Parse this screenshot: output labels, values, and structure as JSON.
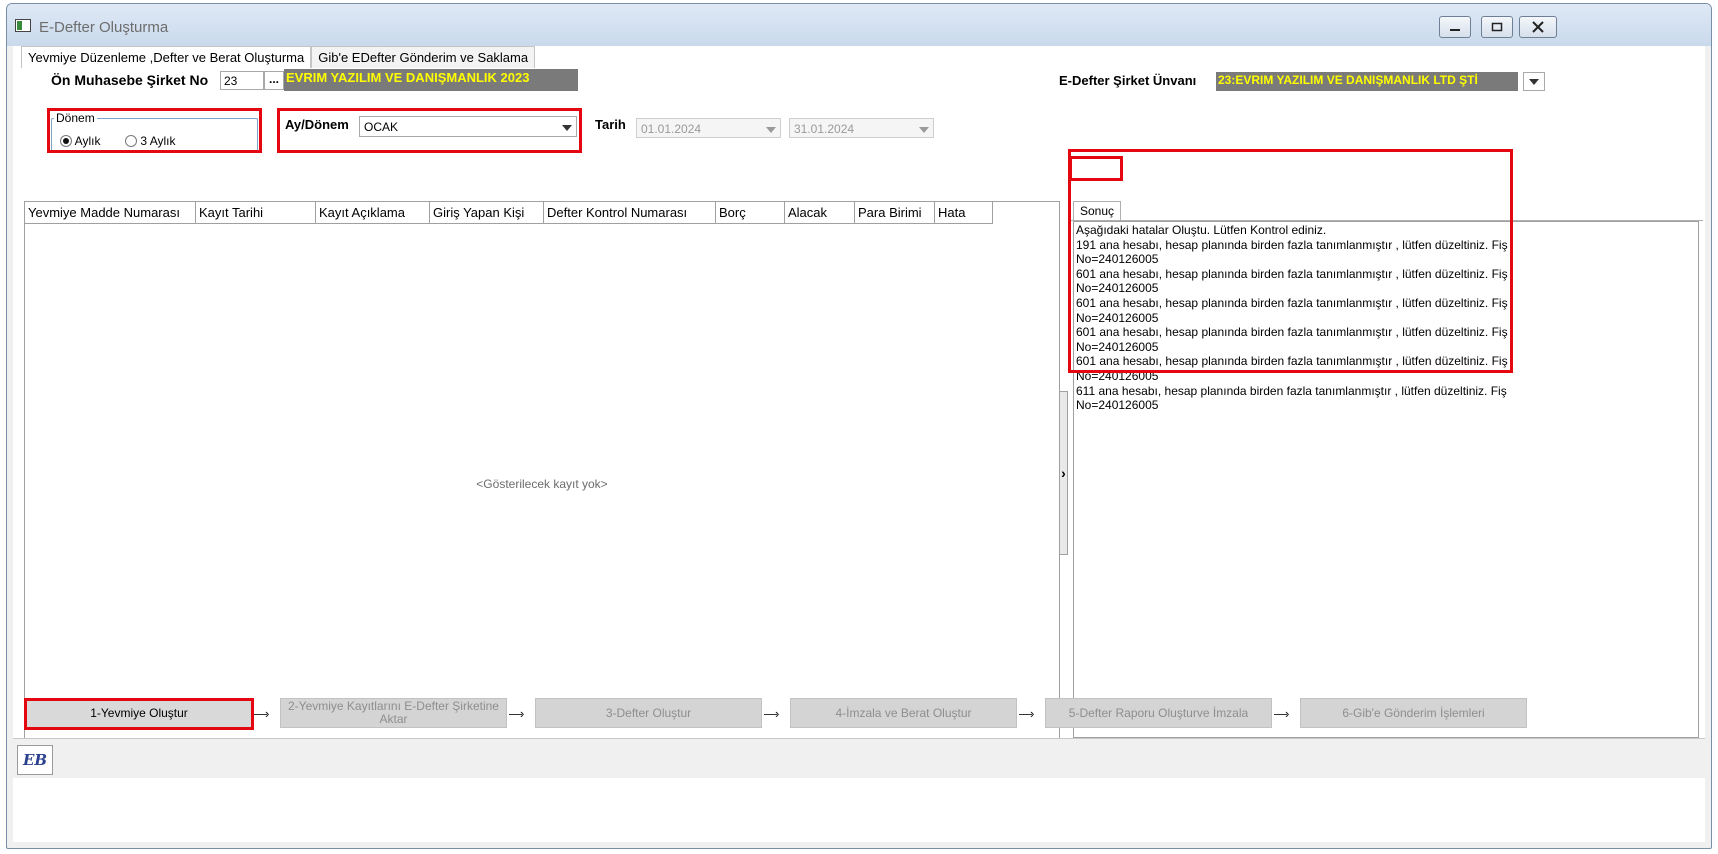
{
  "window": {
    "title": "E-Defter Oluşturma"
  },
  "tabs": [
    {
      "label": "Yevmiye Düzenleme ,Defter ve Berat Oluşturma"
    },
    {
      "label": "Gib'e EDefter Gönderim ve Saklama"
    }
  ],
  "company": {
    "label": "Ön Muhasebe Şirket No",
    "no": "23",
    "browse": "...",
    "name": "EVRIM YAZILIM  VE DANIŞMANLIK 2023",
    "edefter_label": "E-Defter Şirket Ünvanı",
    "edefter_value": "23:EVRIM YAZILIM VE DANIŞMANLIK LTD ŞTİ"
  },
  "period": {
    "group_label": "Dönem",
    "options": [
      {
        "label": "Aylık",
        "selected": true
      },
      {
        "label": "3 Aylık",
        "selected": false
      }
    ],
    "ay_label": "Ay/Dönem",
    "ay_value": "OCAK",
    "tarih_label": "Tarih",
    "date_from": "01.01.2024",
    "date_to": "31.01.2024"
  },
  "grid": {
    "columns": [
      "Yevmiye Madde Numarası",
      "Kayıt Tarihi",
      "Kayıt Açıklama",
      "Giriş Yapan Kişi",
      "Defter Kontrol Numarası",
      "Borç",
      "Alacak",
      "Para Birimi",
      "Hata"
    ],
    "empty_text": "<Gösterilecek kayıt yok>"
  },
  "result": {
    "tab_label": "Sonuç",
    "lines": [
      "Aşağıdaki hatalar Oluştu. Lütfen Kontrol ediniz.",
      "191 ana hesabı, hesap planında birden fazla tanımlanmıştır , lütfen düzeltiniz. Fiş",
      "No=240126005",
      "601 ana hesabı, hesap planında birden fazla tanımlanmıştır , lütfen düzeltiniz. Fiş",
      "No=240126005",
      "601 ana hesabı, hesap planında birden fazla tanımlanmıştır , lütfen düzeltiniz. Fiş",
      "No=240126005",
      "601 ana hesabı, hesap planında birden fazla tanımlanmıştır , lütfen düzeltiniz. Fiş",
      "No=240126005",
      "601 ana hesabı, hesap planında birden fazla tanımlanmıştır , lütfen düzeltiniz. Fiş",
      "No=240126005",
      "611 ana hesabı, hesap planında birden fazla tanımlanmıştır , lütfen düzeltiniz. Fiş",
      "No=240126005"
    ]
  },
  "steps": [
    {
      "label": "1-Yevmiye Oluştur",
      "active": true
    },
    {
      "label": "2-Yevmiye Kayıtlarını E-Defter Şirketine Aktar",
      "active": false
    },
    {
      "label": "3-Defter Oluştur",
      "active": false
    },
    {
      "label": "4-İmzala ve Berat Oluştur",
      "active": false
    },
    {
      "label": "5-Defter Raporu Oluşturve İmzala",
      "active": false
    },
    {
      "label": "6-Gib'e Gönderim İşlemleri",
      "active": false
    }
  ],
  "step_arrow": "—›",
  "colors": {
    "highlight_red": "#e4070f",
    "yellow_text": "#ffff00",
    "yellow_bg": "#7a7a7a"
  },
  "status": {
    "logo": "EB"
  }
}
